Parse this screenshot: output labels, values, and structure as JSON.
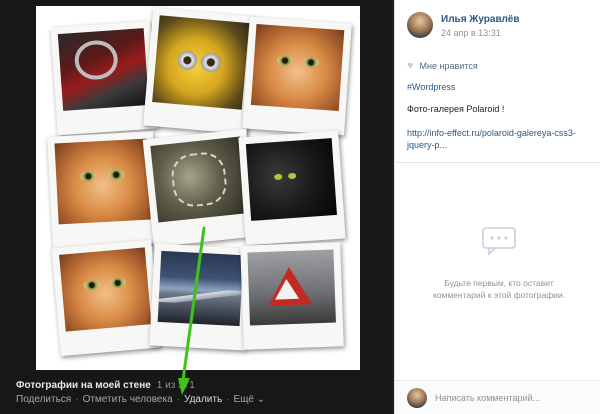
{
  "viewer": {
    "album_title": "Фотографии на моей стене",
    "counter": "1 из 371",
    "actions": {
      "share": "Поделиться",
      "tag": "Отметить человека",
      "delete": "Удалить",
      "more": "Ещё"
    },
    "more_chevron": "⌄",
    "separator": "·"
  },
  "gallery": {
    "items": [
      {
        "icon": "car-interior-photo"
      },
      {
        "icon": "minion-photo"
      },
      {
        "icon": "cat-photo"
      },
      {
        "icon": "cat-photo"
      },
      {
        "icon": "flowers-photo"
      },
      {
        "icon": "black-cat-photo"
      },
      {
        "icon": "cat-photo"
      },
      {
        "icon": "mountain-photo"
      },
      {
        "icon": "road-sign-photo"
      },
      {
        "icon": "sunset-photo"
      }
    ]
  },
  "post": {
    "author": "Илья Журавлёв",
    "date": "24 апр в 13:31",
    "like_label": "Мне нравится",
    "hashtag": "#Wordpress",
    "description": "Фото-галерея Polaroid !",
    "link_line1": "http://info-effect.ru/polaroid-galereya-css3-",
    "link_line2": "jquery-p..."
  },
  "comments": {
    "empty_line1": "Будьте первым, кто оставит",
    "empty_line2": "комментарий к этой фотографии.",
    "input_placeholder": "Написать комментарий..."
  },
  "colors": {
    "link": "#2a5885",
    "arrow": "#3fc21a",
    "viewer_bg": "#171717"
  }
}
